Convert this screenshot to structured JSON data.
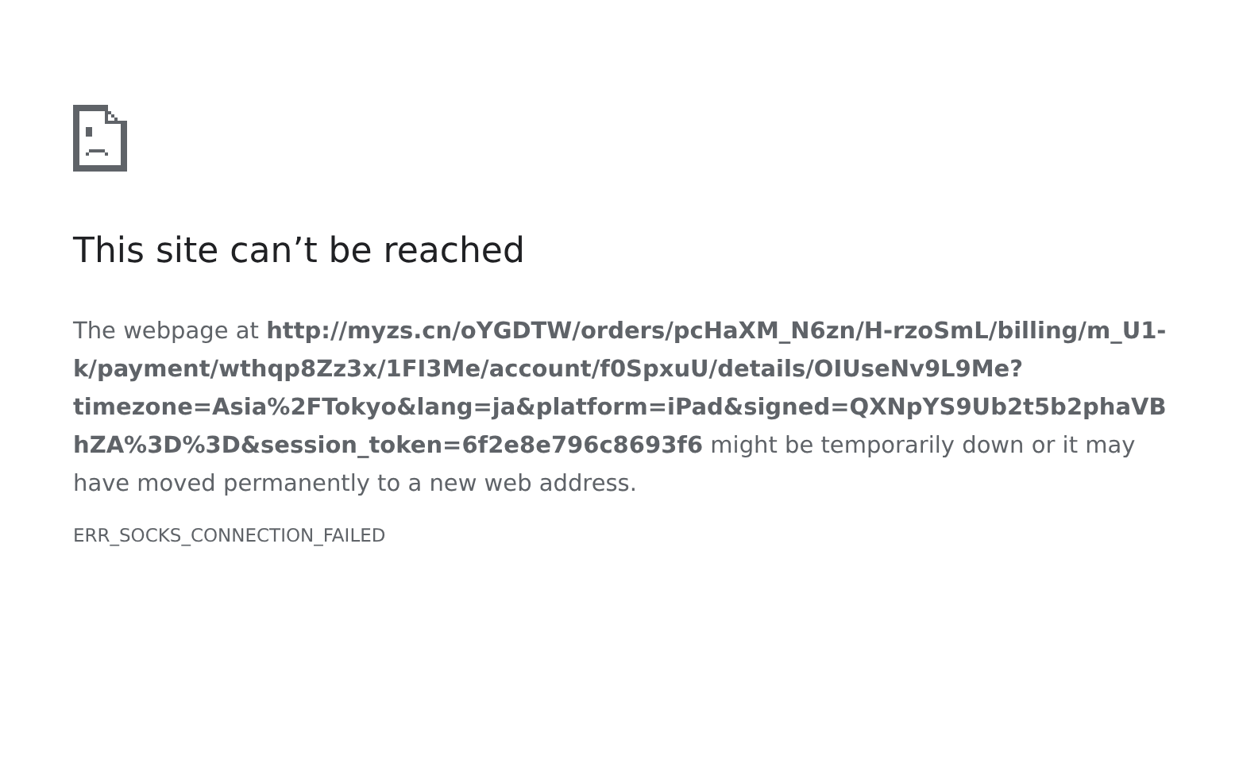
{
  "title": "This site can’t be reached",
  "message": "The webpage at **http://myzs.cn/oYGDTW/orders/pcHaXM_N6zn/H-rzoSmL/billing/m_U1-k/payment/wthqp8Zz3x/1FI3Me/account/f0SpxuU/details/OIUseNv9L9Me?timezone=Asia%2FTokyo&lang=ja&platform=iPad&signed=QXNpYS9Ub2t5b2phaVBhZA%3D%3D&session_token=6f2e8e796c8693f6** might be temporarily down or it may have moved permanently to a new web address.",
  "error_code": "ERR_SOCKS_CONNECTION_FAILED"
}
